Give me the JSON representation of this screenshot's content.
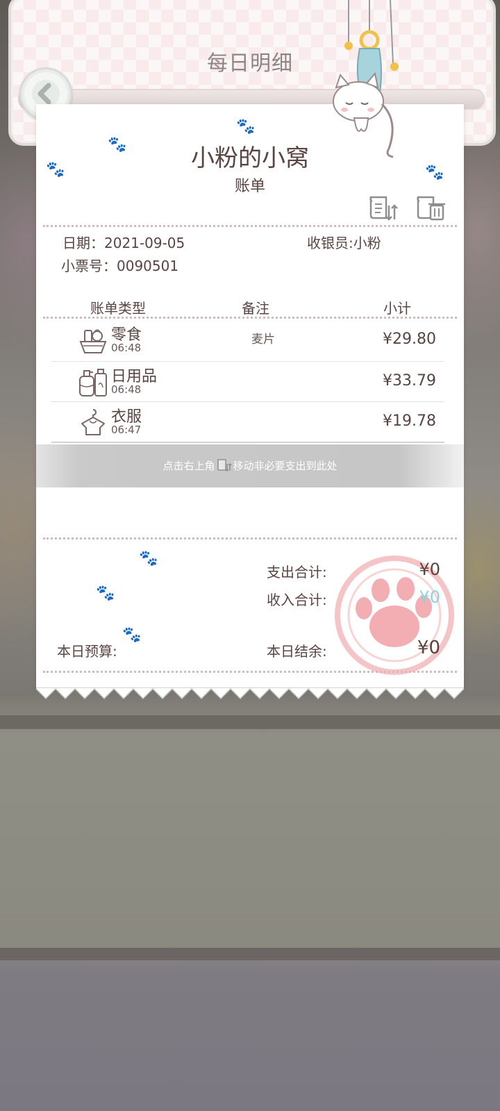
{
  "header": {
    "title": "每日明细"
  },
  "receipt": {
    "shop_name": "小粉的小窝",
    "bill_label": "账单",
    "date_label": "日期：",
    "date_value": "2021-09-05",
    "cashier_label": "收银员:",
    "cashier_value": "小粉",
    "ticket_label": "小票号：",
    "ticket_value": "0090501",
    "columns": {
      "type": "账单类型",
      "note": "备注",
      "subtotal": "小计"
    },
    "rows": [
      {
        "category": "零食",
        "time": "06:48",
        "note": "麦片",
        "amount": "¥29.80",
        "icon": "snack-basket-icon"
      },
      {
        "category": "日用品",
        "time": "06:48",
        "note": "",
        "amount": "¥33.79",
        "icon": "daily-goods-bottle-icon"
      },
      {
        "category": "衣服",
        "time": "06:47",
        "note": "",
        "amount": "¥19.78",
        "icon": "clothes-hanger-icon"
      }
    ],
    "hint": {
      "before": "点击右上角",
      "after": "移动非必要支出到此处"
    },
    "totals": {
      "expense_label": "支出合计:",
      "expense_value": "¥0",
      "income_label": "收入合计:",
      "income_value": "¥0",
      "budget_label": "本日预算:",
      "balance_label": "本日结余:",
      "balance_value": "¥0"
    }
  },
  "colors": {
    "text": "#5a4442",
    "income": "#8fd3d8",
    "stamp": "#f0a0a4",
    "accent_pink": "#f4c6ca"
  }
}
